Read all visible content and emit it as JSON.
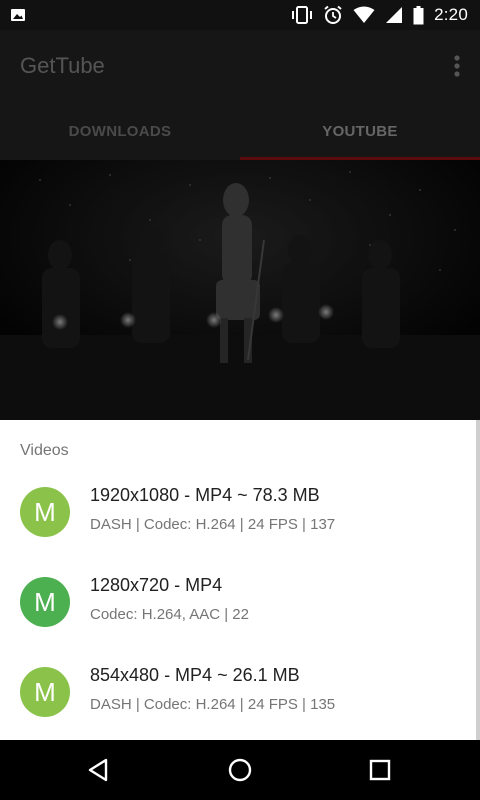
{
  "status_bar": {
    "time": "2:20",
    "icons": [
      "image-icon",
      "vibrate-icon",
      "alarm-icon",
      "wifi-icon",
      "signal-icon",
      "battery-icon"
    ]
  },
  "app": {
    "title": "GetTube",
    "tabs": [
      {
        "label": "DOWNLOADS",
        "active": false
      },
      {
        "label": "YOUTUBE",
        "active": true
      }
    ]
  },
  "sheet": {
    "heading": "Videos",
    "items": [
      {
        "avatar_letter": "M",
        "avatar_color": "#8bc34a",
        "title": "1920x1080 - MP4 ~ 78.3 MB",
        "subtitle": "DASH  |  Codec: H.264  |  24 FPS  |  137"
      },
      {
        "avatar_letter": "M",
        "avatar_color": "#4caf50",
        "title": "1280x720 - MP4",
        "subtitle": "Codec: H.264, AAC  |  22"
      },
      {
        "avatar_letter": "M",
        "avatar_color": "#8bc34a",
        "title": "854x480 - MP4 ~ 26.1 MB",
        "subtitle": "DASH  |  Codec: H.264  |  24 FPS  |  135"
      }
    ]
  },
  "colors": {
    "accent_tab_indicator": "#b71c1c",
    "sheet_background": "#ffffff"
  }
}
